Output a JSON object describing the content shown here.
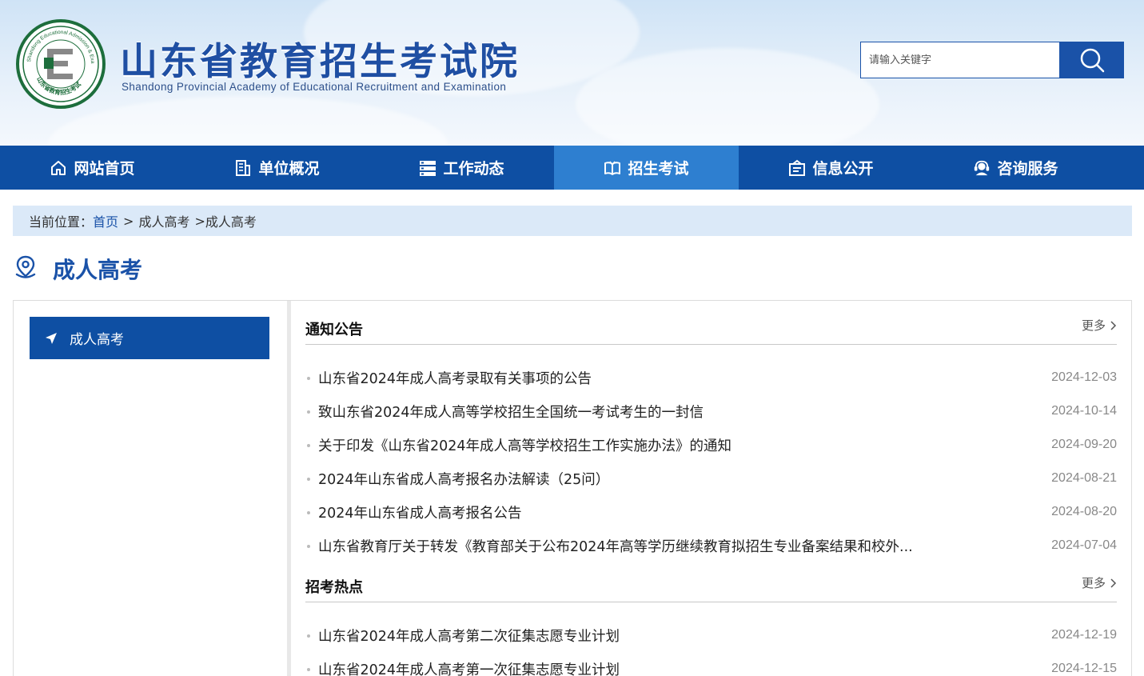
{
  "header": {
    "title": "山东省教育招生考试院",
    "subtitle": "Shandong Provincial Academy of Educational Recruitment and Examination",
    "logo_ring_text": "Shandong Educational Admission & Examination",
    "logo_bottom_text": "山东省教育招生考试",
    "search_placeholder": "请输入关键字",
    "search_icon": "search-icon"
  },
  "nav": {
    "items": [
      {
        "label": "网站首页",
        "icon": "home-icon"
      },
      {
        "label": "单位概况",
        "icon": "building-icon"
      },
      {
        "label": "工作动态",
        "icon": "list-icon"
      },
      {
        "label": "招生考试",
        "icon": "book-icon",
        "active": true
      },
      {
        "label": "信息公开",
        "icon": "info-box-icon"
      },
      {
        "label": "咨询服务",
        "icon": "headset-icon"
      }
    ]
  },
  "breadcrumb": {
    "prefix": "当前位置：",
    "home": "首页",
    "sep1": ">",
    "level1": "成人高考",
    "sep2": ">",
    "level2": "成人高考"
  },
  "page_title": "成人高考",
  "sidebar": {
    "items": [
      {
        "label": "成人高考",
        "icon": "navigation-arrow-icon"
      }
    ]
  },
  "sections": [
    {
      "title": "通知公告",
      "more": "更多",
      "items": [
        {
          "title": "山东省2024年成人高考录取有关事项的公告",
          "date": "2024-12-03"
        },
        {
          "title": "致山东省2024年成人高等学校招生全国统一考试考生的一封信",
          "date": "2024-10-14"
        },
        {
          "title": "关于印发《山东省2024年成人高等学校招生工作实施办法》的通知",
          "date": "2024-09-20"
        },
        {
          "title": "2024年山东省成人高考报名办法解读（25问）",
          "date": "2024-08-21"
        },
        {
          "title": "2024年山东省成人高考报名公告",
          "date": "2024-08-20"
        },
        {
          "title": "山东省教育厅关于转发《教育部关于公布2024年高等学历继续教育拟招生专业备案结果和校外...",
          "date": "2024-07-04"
        }
      ]
    },
    {
      "title": "招考热点",
      "more": "更多",
      "items": [
        {
          "title": "山东省2024年成人高考第二次征集志愿专业计划",
          "date": "2024-12-19"
        },
        {
          "title": "山东省2024年成人高考第一次征集志愿专业计划",
          "date": "2024-12-15"
        }
      ]
    }
  ],
  "colors": {
    "primary": "#0e4fa3",
    "nav_active": "#2e7fd0",
    "breadcrumb_bg": "#dbe9f8",
    "title_blue": "#1a52a8",
    "logo_green": "#1d6e3c"
  }
}
